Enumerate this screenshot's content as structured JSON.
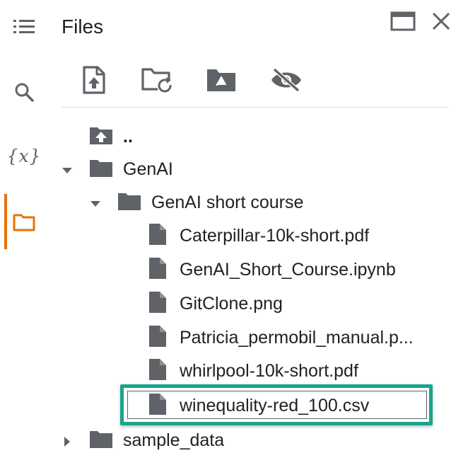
{
  "panel": {
    "title": "Files"
  },
  "icons": {
    "toc": "table-of-contents-icon",
    "search": "search-icon",
    "variables": "variables-icon",
    "files": "folder-icon",
    "open_in_tab": "open-in-tab-icon",
    "close": "close-icon",
    "upload": "upload-file-icon",
    "refresh": "refresh-folder-icon",
    "drive": "mount-drive-icon",
    "hidden": "hide-hidden-files-icon"
  },
  "rail": {
    "variables_glyph": "{x}"
  },
  "colors": {
    "accent": "#e8710a",
    "icon_gray": "#5f6368",
    "highlight": "#1aa38c"
  },
  "tree": {
    "parent": "..",
    "folder_genai": "GenAI",
    "folder_course": "GenAI short course",
    "files": [
      "Caterpillar-10k-short.pdf",
      "GenAI_Short_Course.ipynb",
      "GitClone.png",
      "Patricia_permobil_manual.p...",
      "whirlpool-10k-short.pdf",
      "winequality-red_100.csv"
    ],
    "folder_sample": "sample_data"
  }
}
